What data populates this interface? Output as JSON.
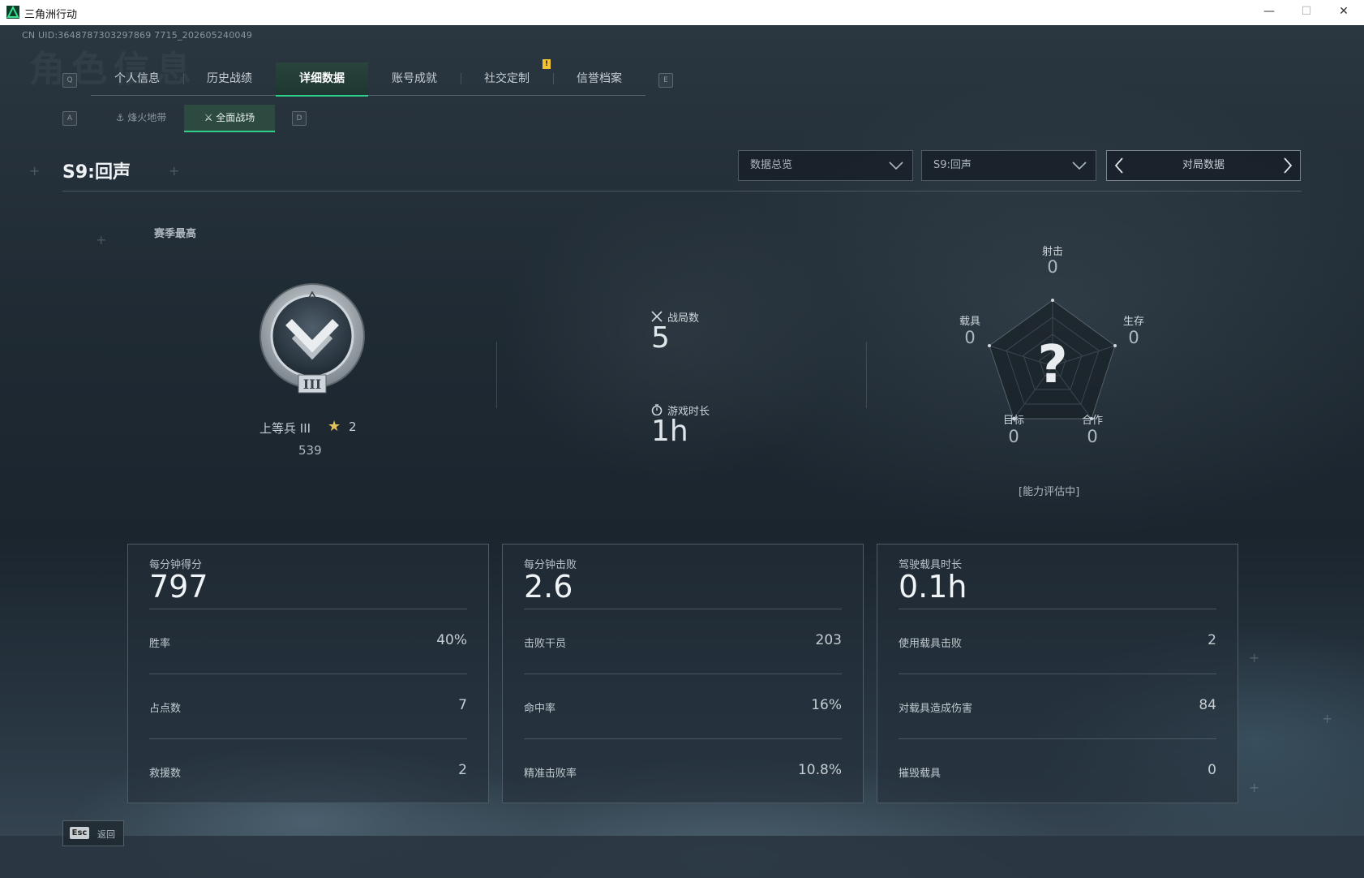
{
  "window": {
    "title": "三角洲行动",
    "controls": {
      "minimize": "—",
      "maximize": "☐",
      "close": "✕"
    }
  },
  "header": {
    "uid": "CN UID:3648787303297869 7715_202605240049",
    "bg_title": "角色信息"
  },
  "tabs": {
    "left_key": "Q",
    "right_key": "E",
    "items": [
      {
        "label": "个人信息",
        "active": false
      },
      {
        "label": "历史战绩",
        "active": false
      },
      {
        "label": "详细数据",
        "active": true
      },
      {
        "label": "账号成就",
        "active": false
      },
      {
        "label": "社交定制",
        "active": false,
        "notification": "!"
      },
      {
        "label": "信誉档案",
        "active": false
      }
    ]
  },
  "subtabs": {
    "left_key": "A",
    "right_key": "D",
    "items": [
      {
        "label": "烽火地带",
        "active": false
      },
      {
        "label": "全面战场",
        "active": true
      }
    ]
  },
  "season": {
    "title": "S9:回声"
  },
  "filters": {
    "overview": "数据总览",
    "season": "S9:回声",
    "pager_label": "对局数据"
  },
  "rank": {
    "section_label": "赛季最高",
    "name": "上等兵 III",
    "stars": "2",
    "points": "539",
    "badge_numeral": "III"
  },
  "summary": {
    "matches_label": "战局数",
    "matches_value": "5",
    "playtime_label": "游戏时长",
    "playtime_value": "1h"
  },
  "radar": {
    "center_mark": "?",
    "note": "[能力评估中]",
    "axes": [
      {
        "label": "射击",
        "value": "0"
      },
      {
        "label": "生存",
        "value": "0"
      },
      {
        "label": "合作",
        "value": "0"
      },
      {
        "label": "目标",
        "value": "0"
      },
      {
        "label": "载具",
        "value": "0"
      }
    ]
  },
  "cards": [
    {
      "title": "每分钟得分",
      "value": "797",
      "rows": [
        {
          "label": "胜率",
          "value": "40%"
        },
        {
          "label": "占点数",
          "value": "7"
        },
        {
          "label": "救援数",
          "value": "2"
        }
      ]
    },
    {
      "title": "每分钟击败",
      "value": "2.6",
      "rows": [
        {
          "label": "击败干员",
          "value": "203"
        },
        {
          "label": "命中率",
          "value": "16%"
        },
        {
          "label": "精准击败率",
          "value": "10.8%"
        }
      ]
    },
    {
      "title": "驾驶载具时长",
      "value": "0.1h",
      "rows": [
        {
          "label": "使用载具击败",
          "value": "2"
        },
        {
          "label": "对载具造成伤害",
          "value": "84"
        },
        {
          "label": "摧毁载具",
          "value": "0"
        }
      ]
    }
  ],
  "footer": {
    "esc_key": "Esc",
    "back_label": "返回"
  },
  "colors": {
    "accent": "#2fd08a",
    "notification": "#f2c230",
    "star": "#e6c25a"
  },
  "icons": {
    "app": "delta-force-app-icon",
    "matches": "crossed-swords-icon",
    "playtime": "stopwatch-icon",
    "dropdown": "chevron-down-icon",
    "prev": "chevron-left-icon",
    "next": "chevron-right-icon",
    "star": "star-icon"
  }
}
